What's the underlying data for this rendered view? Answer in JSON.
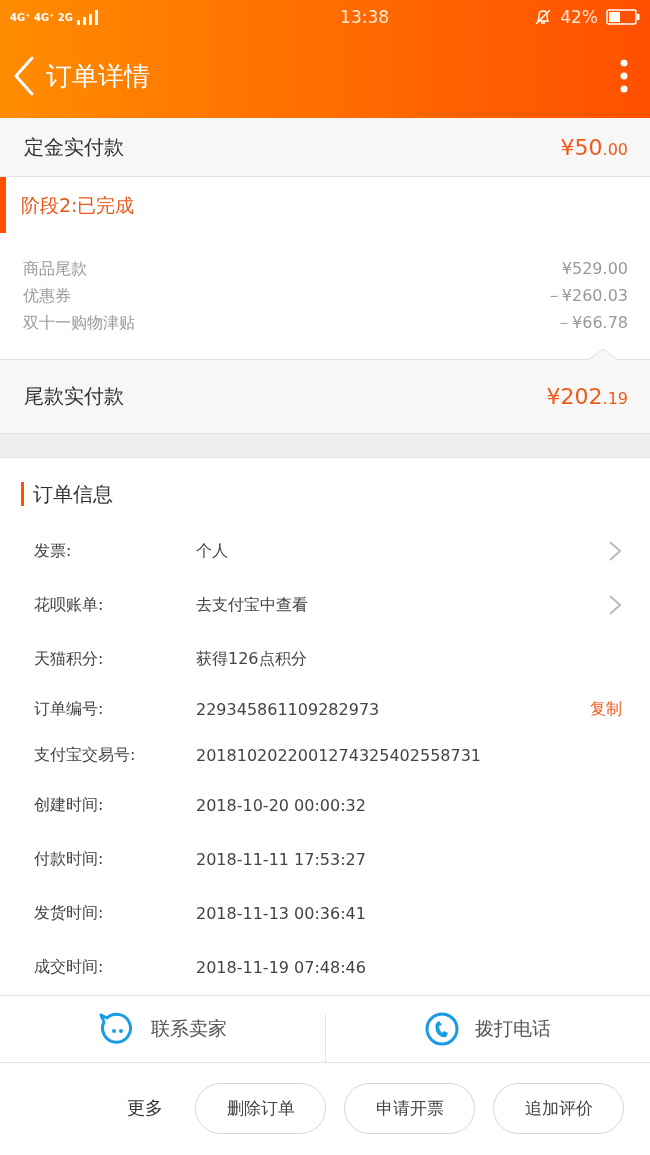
{
  "status_bar": {
    "network": "4G⁺ 4G⁺ 2G",
    "time": "13:38",
    "battery": "42%"
  },
  "header": {
    "title": "订单详情"
  },
  "deposit": {
    "label": "定金实付款",
    "amount": "¥50.00"
  },
  "stage": {
    "title": "阶段2:已完成",
    "lines": [
      {
        "label": "商品尾款",
        "amount": "¥529.00"
      },
      {
        "label": "优惠券",
        "amount": "－¥260.03"
      },
      {
        "label": "双十一购物津贴",
        "amount": "－¥66.78"
      }
    ],
    "total": {
      "label": "尾款实付款",
      "amount": "¥202.19"
    }
  },
  "order_info": {
    "title": "订单信息",
    "rows": [
      {
        "label": "发票:",
        "value": "个人",
        "kind": "link"
      },
      {
        "label": "花呗账单:",
        "value": "去支付宝中查看",
        "kind": "link"
      },
      {
        "label": "天猫积分:",
        "value": "获得126点积分",
        "kind": "plain"
      },
      {
        "label": "订单编号:",
        "value": "229345861109282973",
        "kind": "copy",
        "action": "复制"
      },
      {
        "label": "支付宝交易号:",
        "value": "2018102022001274325402558731",
        "kind": "plain"
      },
      {
        "label": "创建时间:",
        "value": "2018-10-20 00:00:32",
        "kind": "plain"
      },
      {
        "label": "付款时间:",
        "value": "2018-11-11 17:53:27",
        "kind": "plain"
      },
      {
        "label": "发货时间:",
        "value": "2018-11-13 00:36:41",
        "kind": "plain"
      },
      {
        "label": "成交时间:",
        "value": "2018-11-19 07:48:46",
        "kind": "plain"
      }
    ]
  },
  "contact": [
    {
      "label": "联系卖家",
      "kind": "chat"
    },
    {
      "label": "拨打电话",
      "kind": "phone"
    }
  ],
  "bottom_bar": {
    "more": "更多",
    "buttons": [
      "删除订单",
      "申请开票",
      "追加评价"
    ]
  }
}
